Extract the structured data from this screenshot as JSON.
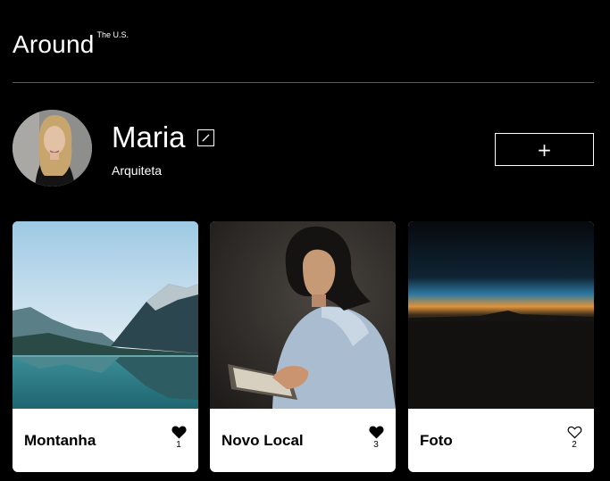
{
  "header": {
    "logo": "Around",
    "logo_sup": "The U.S."
  },
  "profile": {
    "name": "Maria",
    "role": "Arquiteta",
    "add_label": "+"
  },
  "cards": [
    {
      "title": "Montanha",
      "likes": "1",
      "liked": true,
      "icon": "heart-filled-icon"
    },
    {
      "title": "Novo Local",
      "likes": "3",
      "liked": true,
      "icon": "heart-filled-icon"
    },
    {
      "title": "Foto",
      "likes": "2",
      "liked": false,
      "icon": "heart-outline-icon"
    }
  ],
  "colors": {
    "background": "#000000",
    "card": "#ffffff",
    "divider": "#5a5a5a"
  }
}
